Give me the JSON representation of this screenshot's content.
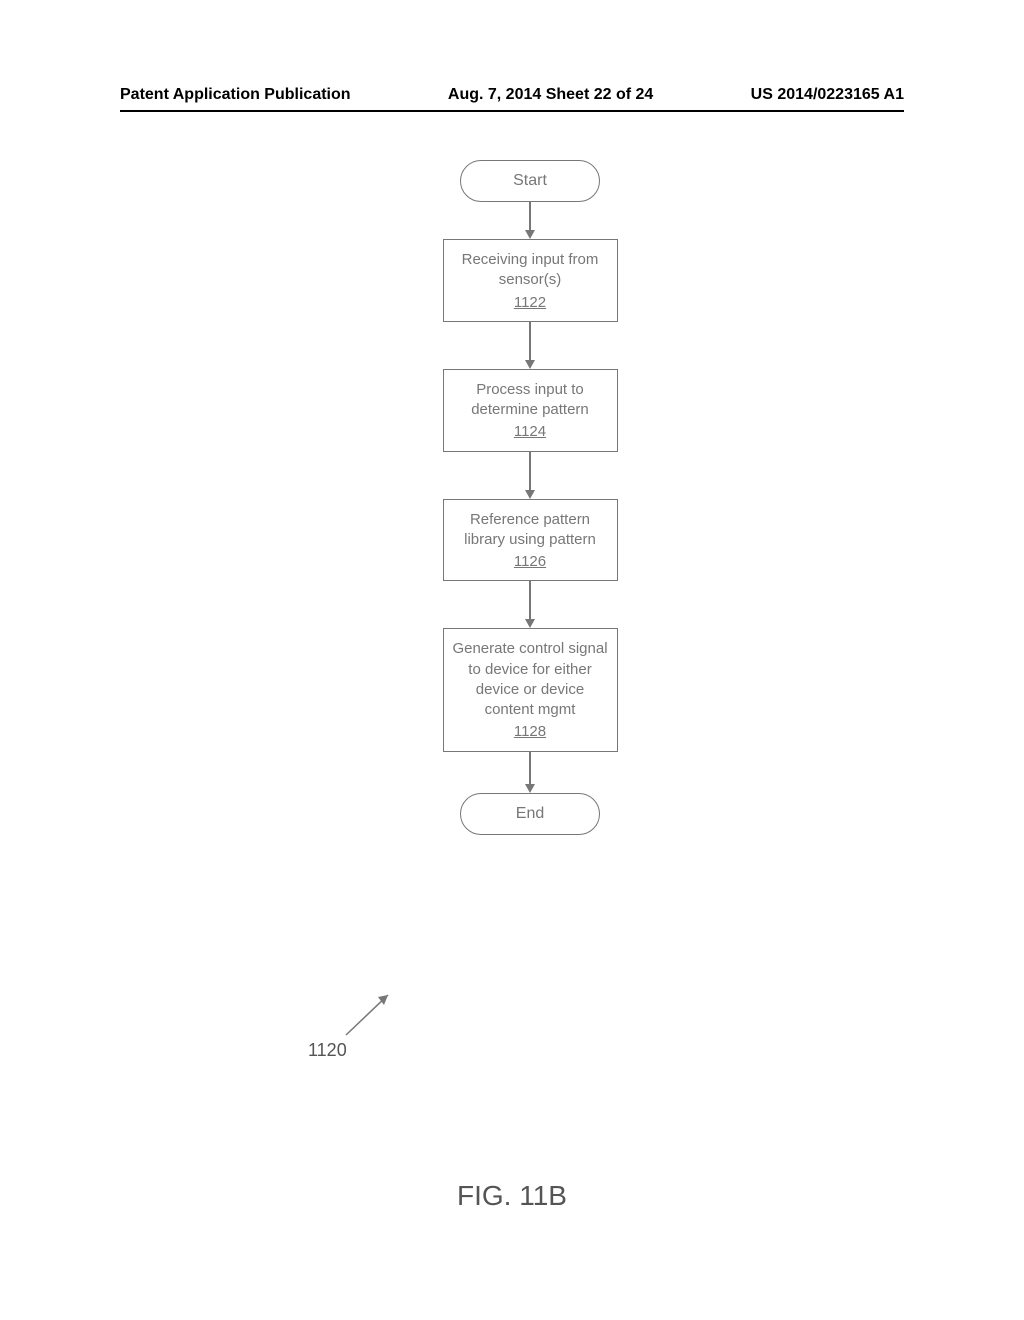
{
  "header": {
    "left": "Patent Application Publication",
    "center": "Aug. 7, 2014  Sheet 22 of 24",
    "right": "US 2014/0223165 A1"
  },
  "flowchart": {
    "start": "Start",
    "end": "End",
    "steps": [
      {
        "text": "Receiving input from sensor(s)",
        "ref": "1122"
      },
      {
        "text": "Process input to determine pattern",
        "ref": "1124"
      },
      {
        "text": "Reference pattern library using pattern",
        "ref": "1126"
      },
      {
        "text": "Generate control signal to device for either device or device content mgmt",
        "ref": "1128"
      }
    ]
  },
  "pointer_label": "1120",
  "figure_caption": "FIG. 11B"
}
